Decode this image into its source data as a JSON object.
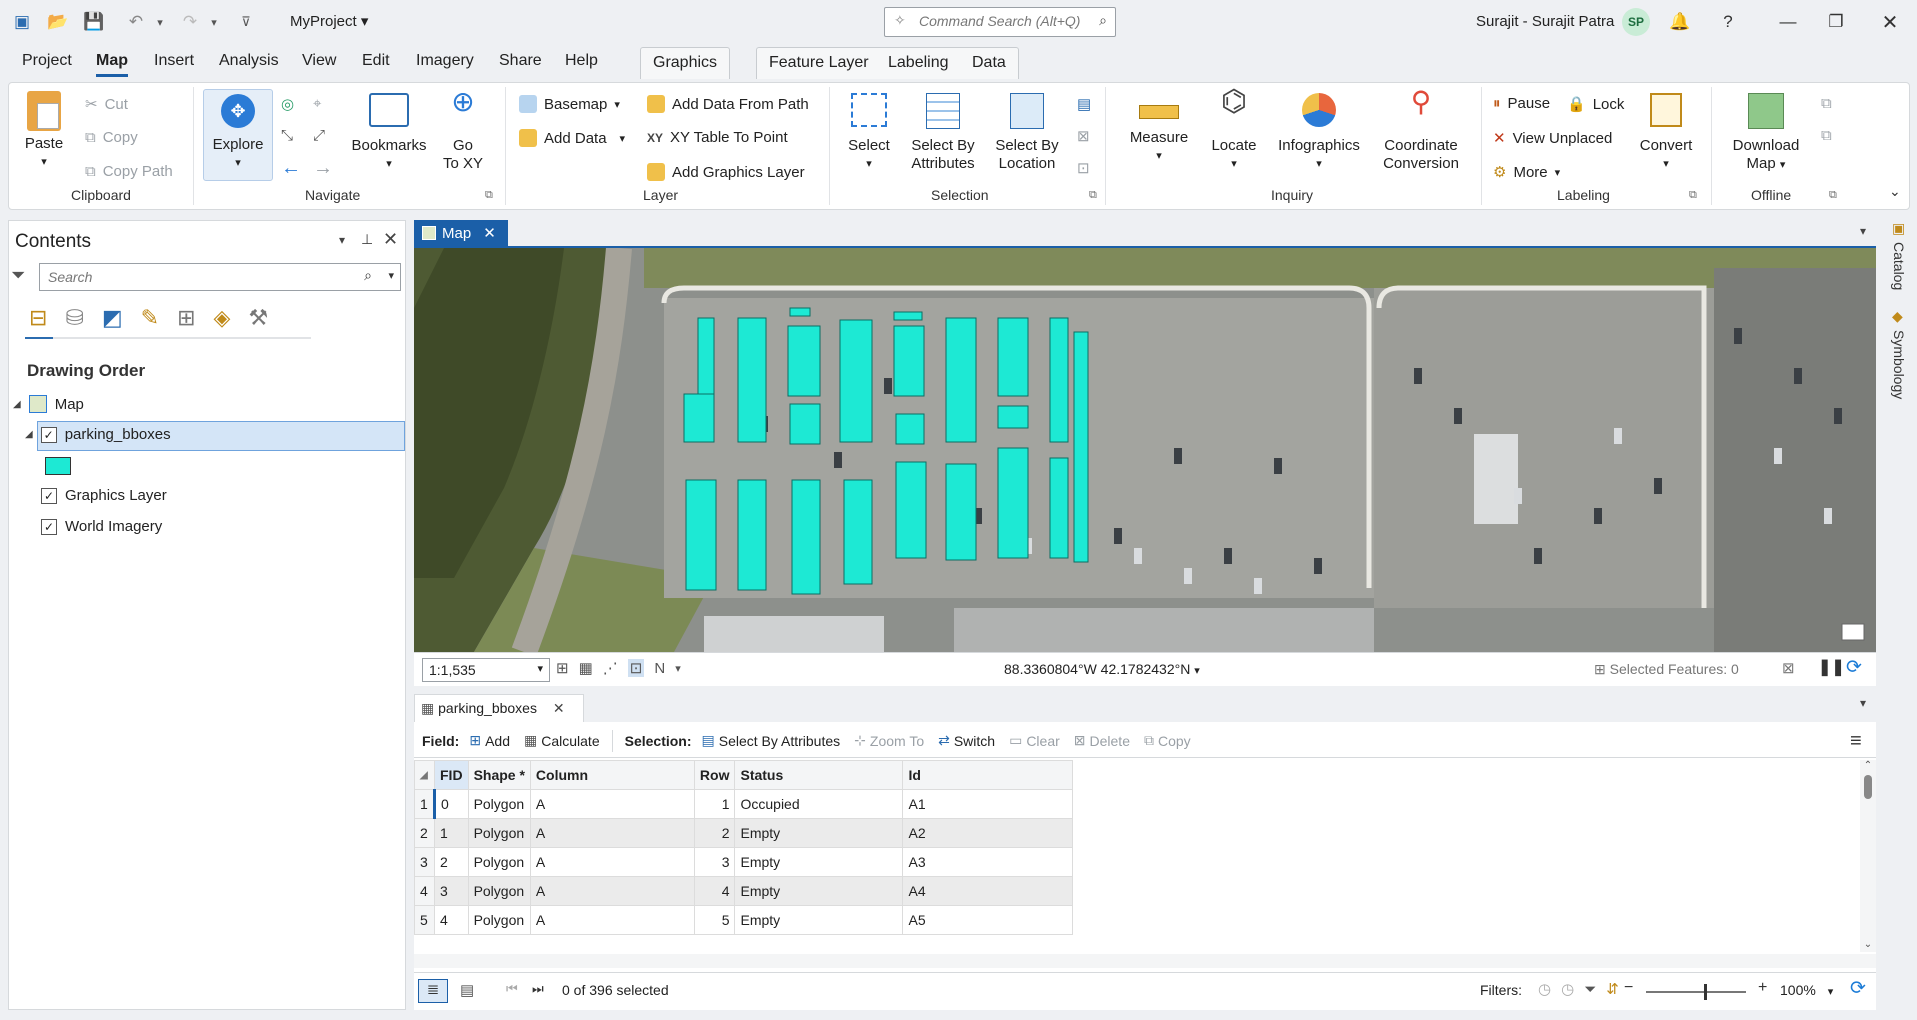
{
  "title_bar": {
    "project_name": "MyProject",
    "command_search_placeholder": "Command Search (Alt+Q)",
    "user_name": "Surajit - Surajit Patra",
    "user_initials": "SP"
  },
  "menu": {
    "tabs": [
      "Project",
      "Map",
      "Insert",
      "Analysis",
      "View",
      "Edit",
      "Imagery",
      "Share",
      "Help"
    ],
    "active": "Map",
    "contextual_tabs": [
      "Graphics",
      "Feature Layer",
      "Labeling",
      "Data"
    ]
  },
  "ribbon": {
    "clipboard": {
      "paste": "Paste",
      "cut": "Cut",
      "copy": "Copy",
      "copy_path": "Copy Path",
      "group": "Clipboard"
    },
    "navigate": {
      "explore": "Explore",
      "bookmarks": "Bookmarks",
      "go_to_xy_1": "Go",
      "go_to_xy_2": "To XY",
      "group": "Navigate"
    },
    "layer": {
      "basemap": "Basemap",
      "add_data": "Add Data",
      "add_data_from_path": "Add Data From Path",
      "xy_table_to_point": "XY Table To Point",
      "add_graphics_layer": "Add Graphics Layer",
      "group": "Layer"
    },
    "selection": {
      "select": "Select",
      "select_by_attributes_1": "Select By",
      "select_by_attributes_2": "Attributes",
      "select_by_location_1": "Select By",
      "select_by_location_2": "Location",
      "group": "Selection"
    },
    "inquiry": {
      "measure": "Measure",
      "locate": "Locate",
      "infographics": "Infographics",
      "coord_1": "Coordinate",
      "coord_2": "Conversion",
      "group": "Inquiry"
    },
    "labeling": {
      "pause": "Pause",
      "lock": "Lock",
      "view_unplaced": "View Unplaced",
      "more": "More",
      "convert": "Convert",
      "group": "Labeling"
    },
    "offline": {
      "download_1": "Download",
      "download_2": "Map",
      "group": "Offline"
    }
  },
  "contents": {
    "title": "Contents",
    "search_placeholder": "Search",
    "drawing_order": "Drawing Order",
    "map_item": "Map",
    "layers": [
      "parking_bboxes",
      "Graphics Layer",
      "World Imagery"
    ],
    "symbol_color": "#1de9d4"
  },
  "map_view": {
    "tab": "Map",
    "scale": "1:1,535",
    "coordinates": "88.3360804°W 42.1782432°N",
    "selected_features": "Selected Features: 0"
  },
  "attribute_table": {
    "tab": "parking_bboxes",
    "field_label": "Field:",
    "add": "Add",
    "calculate": "Calculate",
    "selection_label": "Selection:",
    "select_by_attributes": "Select By Attributes",
    "zoom_to": "Zoom To",
    "switch": "Switch",
    "clear": "Clear",
    "delete": "Delete",
    "copy": "Copy",
    "columns": [
      "FID",
      "Shape *",
      "Column",
      "Row",
      "Status",
      "Id"
    ],
    "rows": [
      {
        "n": "1",
        "fid": "0",
        "shape": "Polygon",
        "column": "A",
        "row": "1",
        "status": "Occupied",
        "id": "A1"
      },
      {
        "n": "2",
        "fid": "1",
        "shape": "Polygon",
        "column": "A",
        "row": "2",
        "status": "Empty",
        "id": "A2"
      },
      {
        "n": "3",
        "fid": "2",
        "shape": "Polygon",
        "column": "A",
        "row": "3",
        "status": "Empty",
        "id": "A3"
      },
      {
        "n": "4",
        "fid": "3",
        "shape": "Polygon",
        "column": "A",
        "row": "4",
        "status": "Empty",
        "id": "A4"
      },
      {
        "n": "5",
        "fid": "4",
        "shape": "Polygon",
        "column": "A",
        "row": "5",
        "status": "Empty",
        "id": "A5"
      }
    ],
    "selected_count": "0 of 396 selected",
    "filters": "Filters:",
    "zoom": "100%"
  },
  "right_panes": [
    "Catalog",
    "Symbology"
  ]
}
